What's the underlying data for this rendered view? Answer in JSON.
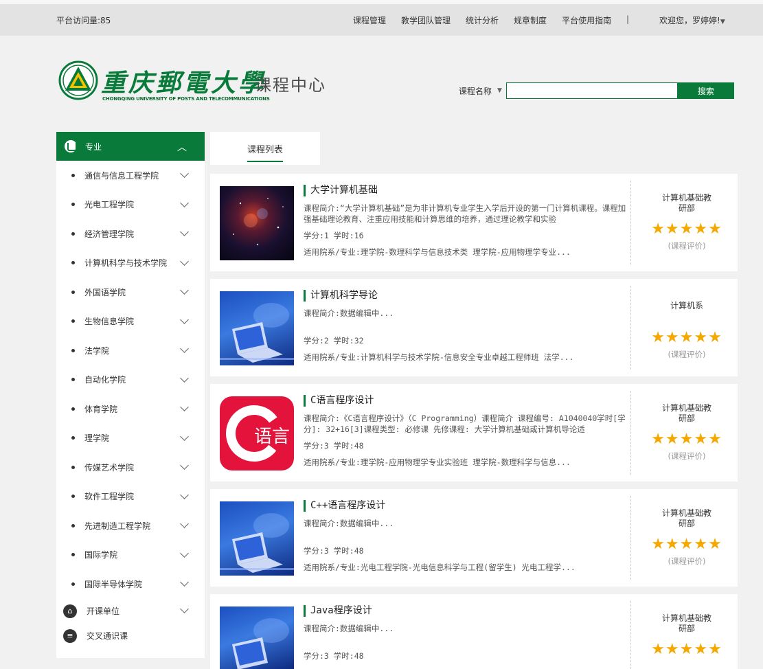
{
  "topbar": {
    "visits": "平台访问量:85",
    "nav": [
      "课程管理",
      "教学团队管理",
      "统计分析",
      "规章制度",
      "平台使用指南"
    ],
    "separator": "|",
    "welcome": "欢迎您，罗婷婷!"
  },
  "logo": {
    "university_cn": "重庆郵電大學",
    "university_en": "CHONGQING UNIVERSITY OF POSTS AND TELECOMMUNICATIONS",
    "center": "课程中心"
  },
  "search": {
    "label": "课程名称",
    "value": "",
    "button": "搜索"
  },
  "sidebar": {
    "header": "专业",
    "items": [
      "通信与信息工程学院",
      "光电工程学院",
      "经济管理学院",
      "计算机科学与技术学院",
      "外国语学院",
      "生物信息学院",
      "法学院",
      "自动化学院",
      "体育学院",
      "理学院",
      "传媒艺术学院",
      "软件工程学院",
      "先进制造工程学院",
      "国际学院",
      "国际半导体学院"
    ],
    "sections": [
      "开课单位",
      "交叉通识课"
    ]
  },
  "tabs": {
    "course_list": "课程列表"
  },
  "courses": [
    {
      "title": "大学计算机基础",
      "intro": "课程简介:“大学计算机基础”是为非计算机专业学生入学后开设的第一门计算机课程。课程加强基础理论教育、注重应用技能和计算思维的培养，通过理论教学和实验",
      "credits": "学分:1  学时:16",
      "applies": "适用院系/专业:理学院-数理科学与信息技术类 理学院-应用物理学专业...",
      "dept": "计算机基础教研部",
      "rating": 5,
      "rate_link": "(课程评价)"
    },
    {
      "title": "计算机科学导论",
      "intro": "课程简介:数据编辑中...",
      "credits": "学分:2  学时:32",
      "applies": "适用院系/专业:计算机科学与技术学院-信息安全专业卓越工程师班 法学...",
      "dept": "计算机系",
      "rating": 5,
      "rate_link": "(课程评价)"
    },
    {
      "title": "C语言程序设计",
      "intro": "课程简介:《C语言程序设计》（C Programming）课程简介 课程编号: A1040040学时[学分]: 32+16[3]课程类型: 必修课 先修课程: 大学计算机基础或计算机导论适",
      "credits": "学分:3  学时:48",
      "applies": "适用院系/专业:理学院-应用物理学专业实验班 理学院-数理科学与信息...",
      "dept": "计算机基础教研部",
      "rating": 5,
      "rate_link": "(课程评价)",
      "thumb_text": "语言"
    },
    {
      "title": "C++语言程序设计",
      "intro": "课程简介:数据编辑中...",
      "credits": "学分:3  学时:48",
      "applies": "适用院系/专业:光电工程学院-光电信息科学与工程(留学生) 光电工程学...",
      "dept": "计算机基础教研部",
      "rating": 5,
      "rate_link": "(课程评价)"
    },
    {
      "title": "Java程序设计",
      "intro": "课程简介:数据编辑中...",
      "credits": "学分:3  学时:48",
      "applies": "",
      "dept": "计算机基础教研部",
      "rating": 5,
      "rate_link": ""
    }
  ],
  "colors": {
    "brand": "#0a7a3a",
    "star": "#f4a800",
    "topbar": "#e3e3e3"
  }
}
